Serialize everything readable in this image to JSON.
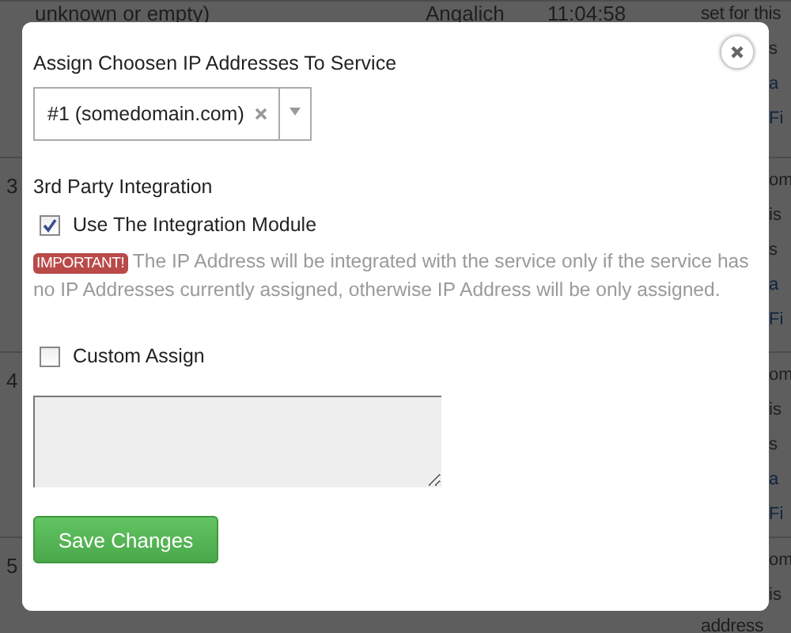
{
  "backdrop": {
    "rows": [
      {
        "number": "",
        "cells": [
          "unknown or empty)",
          "Angalich",
          "11:04:58",
          "set for this"
        ],
        "fragments": [
          {
            "text": "s",
            "kind": "text"
          },
          {
            "text": "a",
            "kind": "link"
          },
          {
            "text": "Fi",
            "kind": "link"
          }
        ]
      },
      {
        "number": "3",
        "cells": [],
        "fragments": [
          {
            "text": "om",
            "kind": "text"
          },
          {
            "text": "is",
            "kind": "text"
          },
          {
            "text": "s",
            "kind": "text"
          },
          {
            "text": "a",
            "kind": "link"
          },
          {
            "text": "Fi",
            "kind": "link"
          }
        ]
      },
      {
        "number": "4",
        "cells": [],
        "fragments": [
          {
            "text": "om",
            "kind": "text"
          },
          {
            "text": "is",
            "kind": "text"
          },
          {
            "text": "s",
            "kind": "text"
          },
          {
            "text": "a",
            "kind": "link"
          },
          {
            "text": "Fi",
            "kind": "link"
          }
        ]
      },
      {
        "number": "5",
        "cells": [],
        "fragments": [
          {
            "text": "om",
            "kind": "text"
          },
          {
            "text": "is",
            "kind": "text"
          }
        ],
        "bottom": "address"
      }
    ]
  },
  "dialog": {
    "title": "Assign Choosen IP Addresses To Service",
    "select": {
      "value": "#1 (somedomain.com)"
    },
    "section": "3rd Party Integration",
    "integration": {
      "label": "Use The Integration Module",
      "checked": true
    },
    "notice": {
      "badge": "IMPORTANT!",
      "text": "The IP Address will be integrated with the service only if the service has no IP Addresses currently assigned, otherwise IP Address will be only assigned."
    },
    "custom": {
      "label": "Custom Assign",
      "checked": false
    },
    "button": "Save Changes"
  }
}
